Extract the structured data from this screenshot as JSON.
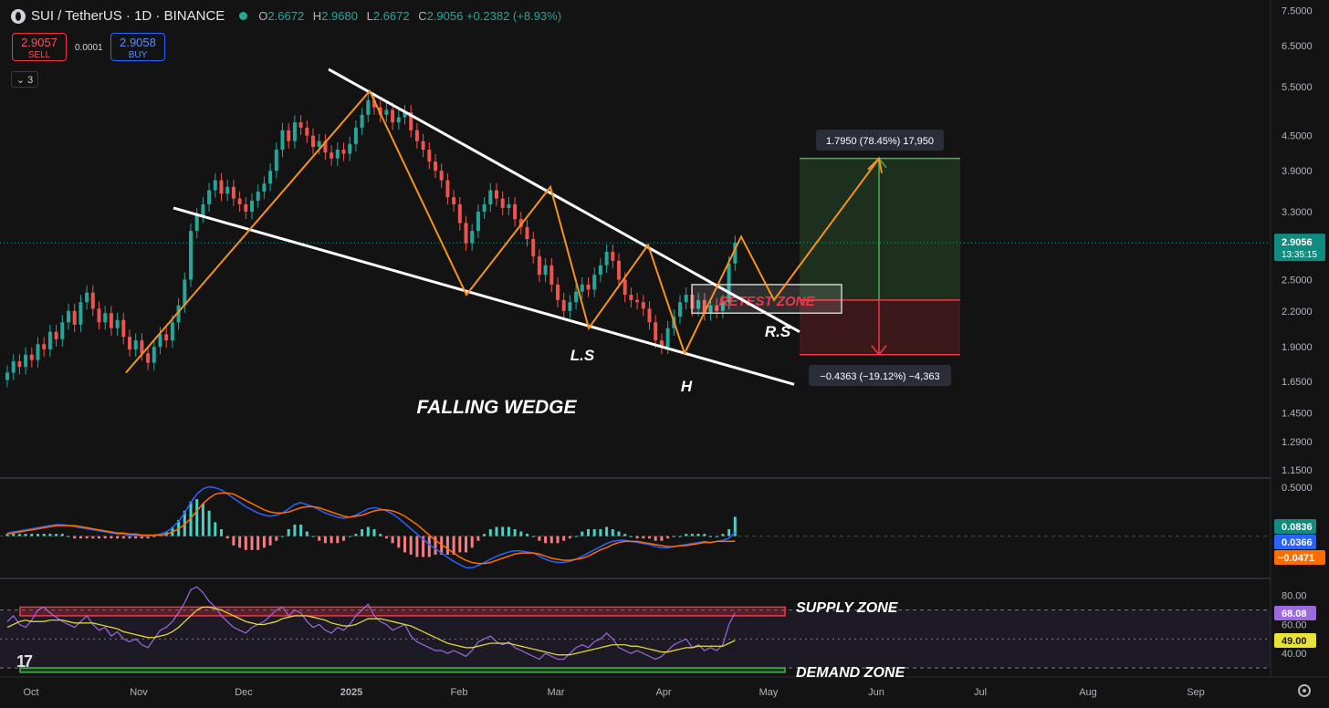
{
  "header": {
    "symbol": "SUI / TetherUS · 1D · BINANCE",
    "o_label": "O",
    "o_value": "2.6672",
    "h_label": "H",
    "h_value": "2.9680",
    "l_label": "L",
    "l_value": "2.6672",
    "c_label": "C",
    "c_value": "2.9056 +0.2382 (+8.93%)"
  },
  "trade": {
    "sell_price": "2.9057",
    "sell_label": "SELL",
    "spread": "0.0001",
    "buy_price": "2.9058",
    "buy_label": "BUY",
    "indicator_count": "3"
  },
  "colors": {
    "up": "#26a69a",
    "down": "#ef5350",
    "wedge": "#ffffff",
    "pattern": "#f7931a",
    "supply": "#f23645",
    "demand": "#4caf50"
  },
  "chart_data": [
    {
      "type": "line",
      "scale": "log",
      "title": "",
      "xlabel": "",
      "ylabel": "",
      "ylim": [
        1.12,
        7.6
      ],
      "x_ticks": [
        "Oct",
        "Nov",
        "Dec",
        "2025",
        "Feb",
        "Mar",
        "Apr",
        "May",
        "Jun",
        "Jul",
        "Aug",
        "Sep"
      ],
      "y_ticks": [
        "7.5000",
        "6.5000",
        "5.5000",
        "4.5000",
        "3.9000",
        "3.3000",
        "2.5000",
        "2.2000",
        "1.9000",
        "1.6500",
        "1.4500",
        "1.2900",
        "1.1500"
      ],
      "series": [
        {
          "type": "candlestick",
          "close": [
            1.71,
            1.79,
            1.75,
            1.84,
            1.8,
            1.92,
            1.88,
            2.02,
            1.96,
            2.1,
            2.2,
            2.08,
            2.28,
            2.37,
            2.22,
            2.1,
            2.18,
            2.05,
            2.12,
            1.98,
            1.88,
            1.95,
            1.85,
            1.78,
            1.9,
            2.0,
            1.95,
            2.1,
            2.25,
            2.5,
            3.05,
            3.25,
            3.4,
            3.6,
            3.75,
            3.55,
            3.65,
            3.48,
            3.4,
            3.3,
            3.45,
            3.58,
            3.7,
            3.9,
            4.25,
            4.6,
            4.4,
            4.75,
            4.65,
            4.5,
            4.3,
            4.4,
            4.2,
            4.1,
            4.25,
            4.18,
            4.35,
            4.65,
            4.9,
            5.2,
            5.05,
            4.9,
            5.0,
            4.75,
            4.85,
            4.95,
            4.6,
            4.4,
            4.25,
            4.05,
            3.9,
            3.75,
            3.5,
            3.4,
            3.15,
            2.9,
            3.05,
            3.3,
            3.4,
            3.6,
            3.48,
            3.35,
            3.4,
            3.2,
            3.1,
            2.95,
            2.75,
            2.55,
            2.65,
            2.45,
            2.3,
            2.2,
            2.28,
            2.38,
            2.45,
            2.4,
            2.55,
            2.65,
            2.8,
            2.7,
            2.5,
            2.35,
            2.3,
            2.28,
            2.22,
            2.1,
            1.95,
            1.9,
            2.05,
            2.15,
            2.28,
            2.35,
            2.22,
            2.3,
            2.18,
            2.25,
            2.2,
            2.28,
            2.67,
            2.9056
          ],
          "open": [
            1.66,
            1.71,
            1.79,
            1.75,
            1.84,
            1.8,
            1.92,
            1.88,
            2.02,
            1.96,
            2.1,
            2.2,
            2.08,
            2.28,
            2.37,
            2.22,
            2.1,
            2.18,
            2.05,
            2.12,
            1.98,
            1.88,
            1.95,
            1.85,
            1.78,
            1.9,
            2.0,
            1.95,
            2.1,
            2.25,
            2.5,
            3.05,
            3.25,
            3.4,
            3.6,
            3.75,
            3.55,
            3.65,
            3.48,
            3.4,
            3.3,
            3.45,
            3.58,
            3.7,
            3.9,
            4.25,
            4.6,
            4.4,
            4.75,
            4.65,
            4.5,
            4.3,
            4.4,
            4.2,
            4.1,
            4.25,
            4.18,
            4.35,
            4.65,
            4.9,
            5.2,
            5.05,
            4.9,
            5.0,
            4.75,
            4.85,
            4.95,
            4.6,
            4.4,
            4.25,
            4.05,
            3.9,
            3.75,
            3.5,
            3.4,
            3.15,
            2.9,
            3.05,
            3.3,
            3.4,
            3.6,
            3.48,
            3.35,
            3.4,
            3.2,
            3.1,
            2.95,
            2.75,
            2.55,
            2.65,
            2.45,
            2.3,
            2.2,
            2.28,
            2.38,
            2.45,
            2.4,
            2.55,
            2.65,
            2.8,
            2.7,
            2.5,
            2.35,
            2.3,
            2.28,
            2.22,
            2.1,
            1.95,
            1.9,
            2.05,
            2.15,
            2.28,
            2.35,
            2.22,
            2.3,
            2.18,
            2.25,
            2.2,
            2.28,
            2.67
          ]
        }
      ],
      "annotations": {
        "pattern_title": "FALLING WEDGE",
        "left_shoulder": "L.S",
        "head": "H",
        "right_shoulder": "R.S",
        "retest_label": "RETEST ZONE",
        "target_label": "1.7950 (78.45%) 17,950",
        "stop_label": "−0.4363 (−19.12%) −4,363",
        "target_price": 4.1,
        "entry_price": 2.3,
        "stop_price": 1.84,
        "wedge_upper": [
          [
            5.9,
            29
          ],
          [
            2.02,
            129
          ]
        ],
        "wedge_lower": [
          [
            3.35,
            0
          ],
          [
            1.63,
            146
          ]
        ],
        "zigzag": [
          [
            1.71,
            0
          ],
          [
            5.4,
            31
          ],
          [
            2.35,
            41
          ],
          [
            3.65,
            50
          ],
          [
            2.05,
            54
          ],
          [
            2.88,
            59
          ],
          [
            1.85,
            62
          ],
          [
            2.98,
            68
          ],
          [
            2.3,
            71
          ],
          [
            4.1,
            78
          ]
        ],
        "retest_zone": [
          2.18,
          2.45
        ]
      },
      "last_price": "2.9056",
      "countdown": "13:35:15"
    },
    {
      "type": "line",
      "title": "",
      "y_ticks": [
        "0.5000"
      ],
      "series": [
        {
          "name": "",
          "values": [
            0.03,
            0.04,
            0.05,
            0.06,
            0.07,
            0.08,
            0.09,
            0.1,
            0.11,
            0.11,
            0.1,
            0.09,
            0.08,
            0.07,
            0.06,
            0.05,
            0.04,
            0.03,
            0.02,
            0.02,
            0.01,
            0.01,
            0.0,
            0.0,
            0.01,
            0.02,
            0.04,
            0.08,
            0.14,
            0.22,
            0.32,
            0.4,
            0.45,
            0.47,
            0.46,
            0.44,
            0.4,
            0.36,
            0.32,
            0.28,
            0.25,
            0.22,
            0.2,
            0.19,
            0.2,
            0.22,
            0.26,
            0.3,
            0.32,
            0.3,
            0.28,
            0.25,
            0.22,
            0.2,
            0.18,
            0.17,
            0.18,
            0.2,
            0.23,
            0.26,
            0.27,
            0.26,
            0.24,
            0.21,
            0.17,
            0.12,
            0.07,
            0.02,
            -0.03,
            -0.08,
            -0.12,
            -0.16,
            -0.2,
            -0.24,
            -0.27,
            -0.3,
            -0.3,
            -0.28,
            -0.25,
            -0.22,
            -0.19,
            -0.17,
            -0.15,
            -0.14,
            -0.14,
            -0.15,
            -0.16,
            -0.19,
            -0.22,
            -0.24,
            -0.25,
            -0.25,
            -0.24,
            -0.22,
            -0.19,
            -0.16,
            -0.13,
            -0.1,
            -0.07,
            -0.05,
            -0.04,
            -0.04,
            -0.05,
            -0.06,
            -0.07,
            -0.08,
            -0.1,
            -0.11,
            -0.11,
            -0.1,
            -0.09,
            -0.08,
            -0.07,
            -0.06,
            -0.05,
            -0.06,
            -0.05,
            -0.04,
            -0.02,
            0.0366
          ]
        },
        {
          "name": "",
          "values": [
            0.02,
            0.03,
            0.04,
            0.05,
            0.06,
            0.07,
            0.08,
            0.09,
            0.1,
            0.1,
            0.1,
            0.1,
            0.09,
            0.08,
            0.07,
            0.06,
            0.05,
            0.04,
            0.03,
            0.03,
            0.02,
            0.02,
            0.01,
            0.01,
            0.01,
            0.01,
            0.02,
            0.04,
            0.07,
            0.11,
            0.17,
            0.24,
            0.31,
            0.36,
            0.4,
            0.41,
            0.41,
            0.4,
            0.37,
            0.34,
            0.31,
            0.28,
            0.25,
            0.23,
            0.22,
            0.22,
            0.23,
            0.25,
            0.27,
            0.28,
            0.28,
            0.27,
            0.25,
            0.23,
            0.21,
            0.19,
            0.18,
            0.19,
            0.2,
            0.22,
            0.24,
            0.25,
            0.25,
            0.24,
            0.22,
            0.19,
            0.15,
            0.11,
            0.06,
            0.01,
            -0.04,
            -0.08,
            -0.12,
            -0.16,
            -0.2,
            -0.23,
            -0.25,
            -0.26,
            -0.26,
            -0.25,
            -0.23,
            -0.21,
            -0.19,
            -0.17,
            -0.16,
            -0.16,
            -0.16,
            -0.17,
            -0.19,
            -0.21,
            -0.22,
            -0.23,
            -0.23,
            -0.22,
            -0.21,
            -0.19,
            -0.16,
            -0.13,
            -0.11,
            -0.08,
            -0.06,
            -0.05,
            -0.05,
            -0.05,
            -0.06,
            -0.07,
            -0.08,
            -0.09,
            -0.1,
            -0.1,
            -0.09,
            -0.09,
            -0.08,
            -0.07,
            -0.06,
            -0.06,
            -0.05,
            -0.05,
            -0.05,
            -0.0471
          ]
        }
      ],
      "labels": {
        "hist": "0.0836",
        "macd": "0.0366",
        "signal": "−0.0471"
      }
    },
    {
      "type": "line",
      "title": "",
      "y_ticks": [
        "80.00",
        "60.00",
        "40.00"
      ],
      "ylim": [
        25,
        88
      ],
      "series": [
        {
          "name": "",
          "values": [
            62,
            66,
            60,
            58,
            63,
            70,
            72,
            68,
            65,
            62,
            60,
            58,
            62,
            66,
            60,
            56,
            58,
            52,
            55,
            50,
            48,
            50,
            46,
            44,
            50,
            56,
            58,
            62,
            68,
            75,
            84,
            86,
            82,
            76,
            72,
            66,
            62,
            58,
            56,
            54,
            58,
            60,
            62,
            66,
            70,
            72,
            66,
            70,
            68,
            62,
            58,
            60,
            56,
            54,
            58,
            56,
            60,
            66,
            70,
            74,
            66,
            62,
            60,
            56,
            58,
            60,
            52,
            48,
            46,
            44,
            42,
            42,
            40,
            42,
            40,
            38,
            42,
            48,
            50,
            52,
            48,
            46,
            48,
            44,
            42,
            40,
            38,
            36,
            40,
            38,
            36,
            36,
            40,
            44,
            46,
            44,
            48,
            50,
            54,
            50,
            44,
            42,
            40,
            42,
            40,
            38,
            36,
            38,
            42,
            46,
            48,
            50,
            44,
            46,
            42,
            44,
            42,
            46,
            60,
            68.08
          ]
        },
        {
          "name": "",
          "values": [
            58,
            60,
            62,
            63,
            62,
            62,
            62,
            63,
            63,
            63,
            62,
            61,
            61,
            61,
            61,
            60,
            59,
            58,
            57,
            55,
            54,
            53,
            52,
            51,
            51,
            52,
            53,
            55,
            58,
            62,
            66,
            70,
            72,
            72,
            71,
            70,
            68,
            66,
            64,
            62,
            61,
            60,
            60,
            61,
            62,
            64,
            65,
            66,
            66,
            66,
            65,
            64,
            63,
            61,
            60,
            59,
            59,
            60,
            62,
            64,
            64,
            64,
            63,
            62,
            61,
            60,
            59,
            57,
            55,
            53,
            51,
            49,
            47,
            46,
            45,
            44,
            44,
            45,
            46,
            47,
            47,
            47,
            47,
            46,
            45,
            44,
            43,
            42,
            41,
            40,
            39,
            39,
            39,
            40,
            41,
            42,
            43,
            44,
            45,
            46,
            46,
            46,
            45,
            45,
            44,
            43,
            42,
            41,
            41,
            42,
            43,
            44,
            44,
            45,
            45,
            45,
            45,
            45,
            47,
            49.0
          ]
        }
      ],
      "labels": {
        "rsi": "68.08",
        "ma": "49.00",
        "supply": "SUPPLY ZONE",
        "demand": "DEMAND ZONE"
      },
      "supply_zone": [
        66,
        72
      ],
      "demand_zone": [
        27,
        30
      ]
    }
  ]
}
